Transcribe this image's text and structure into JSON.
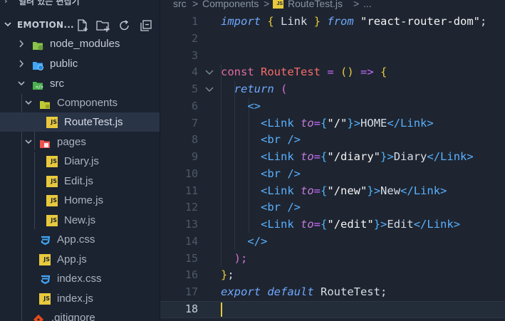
{
  "sidebar": {
    "open_editors_label": "열려 있는 편집기",
    "project_label": "EMOTION...",
    "toolbar_icons": [
      "new-file-icon",
      "new-folder-icon",
      "refresh-icon",
      "collapse-all-icon"
    ],
    "tree": [
      {
        "label": "node_modules",
        "type": "folder",
        "icon": "node-folder-icon",
        "expanded": false
      },
      {
        "label": "public",
        "type": "folder",
        "icon": "public-folder-icon",
        "expanded": false
      },
      {
        "label": "src",
        "type": "folder",
        "icon": "src-folder-icon",
        "expanded": true
      },
      {
        "label": "Components",
        "type": "folder",
        "icon": "components-folder-icon",
        "expanded": true
      },
      {
        "label": "RouteTest.js",
        "type": "file",
        "icon": "js-file-icon",
        "selected": true
      },
      {
        "label": "pages",
        "type": "folder",
        "icon": "pages-folder-icon",
        "expanded": true
      },
      {
        "label": "Diary.js",
        "type": "file",
        "icon": "js-file-icon"
      },
      {
        "label": "Edit.js",
        "type": "file",
        "icon": "js-file-icon"
      },
      {
        "label": "Home.js",
        "type": "file",
        "icon": "js-file-icon"
      },
      {
        "label": "New.js",
        "type": "file",
        "icon": "js-file-icon"
      },
      {
        "label": "App.css",
        "type": "file",
        "icon": "css-file-icon"
      },
      {
        "label": "App.js",
        "type": "file",
        "icon": "js-file-icon"
      },
      {
        "label": "index.css",
        "type": "file",
        "icon": "css-file-icon"
      },
      {
        "label": "index.js",
        "type": "file",
        "icon": "js-file-icon"
      },
      {
        "label": ".gitignore",
        "type": "file",
        "icon": "git-file-icon"
      }
    ]
  },
  "breadcrumb": {
    "parts": [
      "src",
      ">",
      "Components",
      ">",
      "RouteTest.js",
      ">",
      "..."
    ]
  },
  "editor": {
    "line_numbers": [
      "1",
      "2",
      "3",
      "4",
      "5",
      "6",
      "7",
      "8",
      "9",
      "10",
      "11",
      "12",
      "13",
      "14",
      "15",
      "16",
      "17",
      "18"
    ],
    "active_line": "18",
    "code": {
      "l1": {
        "import": "import",
        "b1": "{",
        "name": " Link ",
        "b2": "}",
        "from": "from",
        "str": "\"react-router-dom\"",
        "semi": ";"
      },
      "l3": {
        "const": "const",
        "name": " RouteTest ",
        "eq": "=",
        "p": " () ",
        "arrow": "=>",
        "b": " {"
      },
      "l4": {
        "ret": "return",
        "p": " ("
      },
      "l5": {
        "frag": "<>"
      },
      "l6": {
        "open": "<",
        "tag": "Link",
        "attr": " to",
        "eq": "=",
        "b1": "{",
        "str": "\"/\"",
        "b2": "}",
        "gt": ">",
        "text": "HOME",
        "close1": "</",
        "ctag": "Link",
        "close2": ">"
      },
      "l7": {
        "open": "<",
        "tag": "br",
        "close": " />"
      },
      "l8": {
        "open": "<",
        "tag": "Link",
        "attr": " to",
        "eq": "=",
        "b1": "{",
        "str": "\"/diary\"",
        "b2": "}",
        "gt": ">",
        "text": "Diary",
        "close1": "</",
        "ctag": "Link",
        "close2": ">"
      },
      "l9": {
        "open": "<",
        "tag": "br",
        "close": " />"
      },
      "l10": {
        "open": "<",
        "tag": "Link",
        "attr": " to",
        "eq": "=",
        "b1": "{",
        "str": "\"/new\"",
        "b2": "}",
        "gt": ">",
        "text": "New",
        "close1": "</",
        "ctag": "Link",
        "close2": ">"
      },
      "l11": {
        "open": "<",
        "tag": "br",
        "close": " />"
      },
      "l12": {
        "open": "<",
        "tag": "Link",
        "attr": " to",
        "eq": "=",
        "b1": "{",
        "str": "\"/edit\"",
        "b2": "}",
        "gt": ">",
        "text": "Edit",
        "close1": "</",
        "ctag": "Link",
        "close2": ">"
      },
      "l13": {
        "frag": "</>"
      },
      "l14": {
        "p": ");"
      },
      "l15": {
        "b": "}",
        "semi": ";"
      },
      "l17": {
        "export": "export",
        "def": " default",
        "name": " RouteTest",
        "semi": ";"
      }
    }
  }
}
